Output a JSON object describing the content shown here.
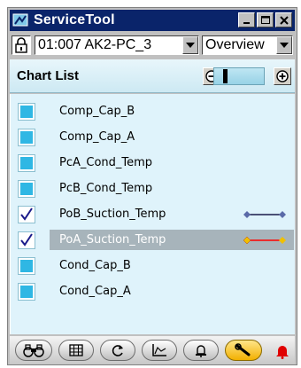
{
  "window": {
    "title": "ServiceTool"
  },
  "toolbar": {
    "device_select_value": "01:007 AK2-PC_3",
    "view_select_value": "Overview"
  },
  "panel": {
    "heading": "Chart List"
  },
  "chart_list": [
    {
      "label": "Comp_Cap_B",
      "checked": false,
      "selected": false
    },
    {
      "label": "Comp_Cap_A",
      "checked": false,
      "selected": false
    },
    {
      "label": "PcA_Cond_Temp",
      "checked": false,
      "selected": false
    },
    {
      "label": "PcB_Cond_Temp",
      "checked": false,
      "selected": false
    },
    {
      "label": "PoB_Suction_Temp",
      "checked": true,
      "selected": false,
      "legend_line_color": "#1a1a4a",
      "legend_marker_color": "#5a6aa8"
    },
    {
      "label": "PoA_Suction_Temp",
      "checked": true,
      "selected": true,
      "legend_line_color": "#ff0000",
      "legend_marker_color": "#f0c000"
    },
    {
      "label": "Cond_Cap_B",
      "checked": false,
      "selected": false
    },
    {
      "label": "Cond_Cap_A",
      "checked": false,
      "selected": false
    }
  ],
  "bottom_toolbar": {
    "buttons": [
      {
        "icon": "binoculars-icon"
      },
      {
        "icon": "grid-icon"
      },
      {
        "icon": "refresh-icon"
      },
      {
        "icon": "chart-icon"
      },
      {
        "icon": "alarm-icon"
      },
      {
        "icon": "wrench-icon",
        "active": true
      }
    ],
    "alarm_indicator_icon": "bell-icon",
    "alarm_indicator_color": "#e00000"
  },
  "colors": {
    "title_bar": "#0a246a",
    "list_background": "#dff3fb",
    "checkbox_fill": "#2fb7e4",
    "selection": "#a7b4bb"
  }
}
